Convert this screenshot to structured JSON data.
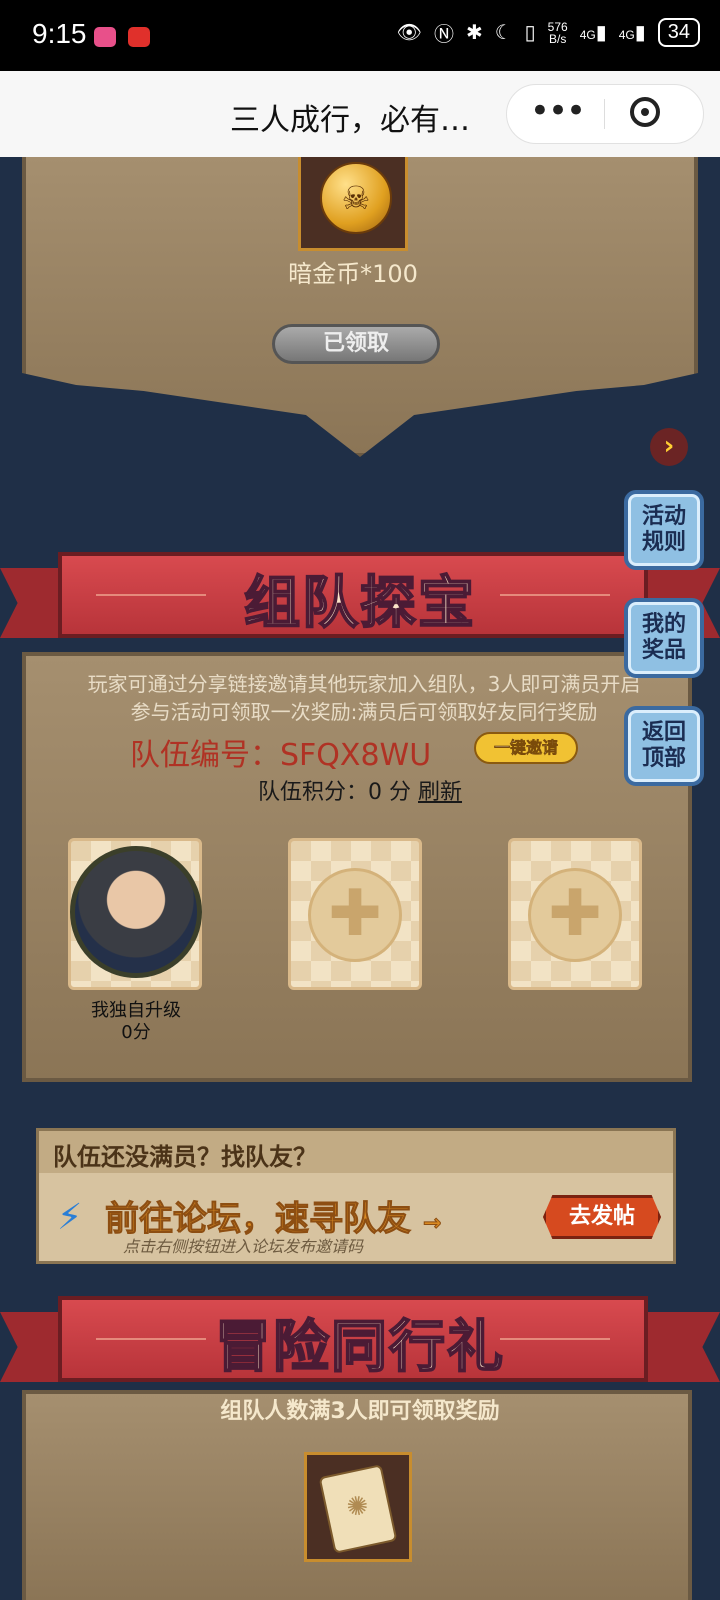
{
  "status_bar": {
    "time": "9:15",
    "net_speed_top": "576",
    "net_speed_bottom": "B/s",
    "signal_a": "4G",
    "signal_b": "4G",
    "battery": "34"
  },
  "title_bar": {
    "title": "三人成行，必有…",
    "more_label": "•••"
  },
  "top_reward": {
    "item_name": "暗金币*100",
    "claim_status": "已领取",
    "coin_glyph": "☠",
    "next_glyph": "›"
  },
  "team_section": {
    "ribbon_title": "组队探宝",
    "desc_line1": "玩家可通过分享链接邀请其他玩家加入组队，3人即可满员开启",
    "desc_line2": "参与活动可领取一次奖励:满员后可领取好友同行奖励",
    "team_id_label": "队伍编号：",
    "team_id": "SFQX8WU",
    "invite_button": "一键邀请",
    "score_label": "队伍积分：",
    "score_value": "0",
    "score_unit": "分",
    "refresh": "刷新",
    "members": [
      {
        "name": "我独自升级",
        "score": "0分"
      }
    ],
    "empty_slot_glyph": "✚"
  },
  "side_buttons": [
    {
      "label_line1": "活动",
      "label_line2": "规则"
    },
    {
      "label_line1": "我的",
      "label_line2": "奖品"
    },
    {
      "label_line1": "返回",
      "label_line2": "顶部"
    }
  ],
  "forum": {
    "header": "队伍还没满员？找队友？",
    "headline": "前往论坛，速寻队友",
    "headline_arrow": "→",
    "hint": "点击右侧按钮进入论坛发布邀请码",
    "button": "去发帖",
    "bolt_glyph": "⚡"
  },
  "adventure_section": {
    "ribbon_title": "冒险同行礼",
    "subtitle": "组队人数满3人即可领取奖励",
    "scroll_glyph": "✺"
  },
  "colors": {
    "background": "#1f2f47",
    "parchment": "#a58f6f",
    "ribbon_red": "#c63c42",
    "team_id_red": "#b03224",
    "side_button_blue": "#8fc0e3"
  }
}
